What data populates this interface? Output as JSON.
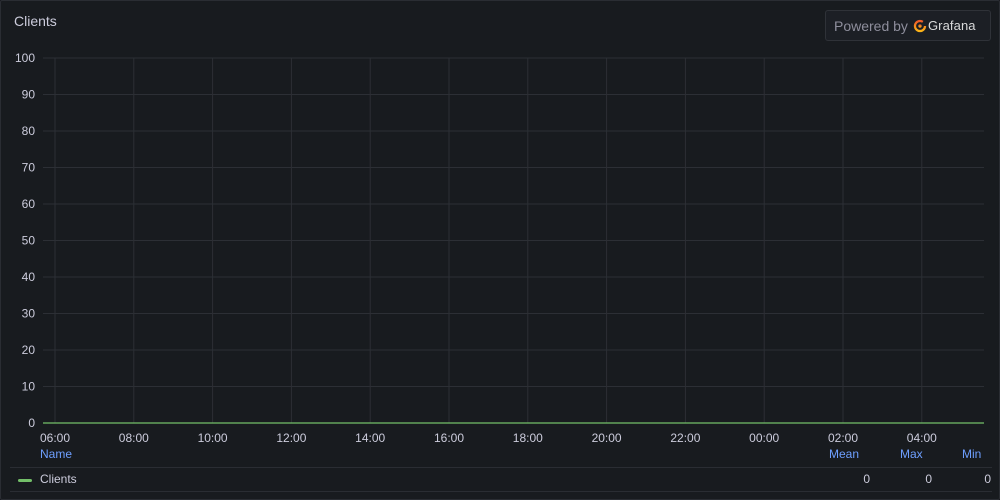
{
  "panel": {
    "title": "Clients"
  },
  "branding": {
    "powered_by": "Powered by",
    "brand": "Grafana",
    "logo_icon": "grafana-logo-icon"
  },
  "legend": {
    "headers": {
      "name": "Name",
      "mean": "Mean",
      "max": "Max",
      "min": "Min"
    },
    "rows": [
      {
        "name": "Clients",
        "mean": "0",
        "max": "0",
        "min": "0",
        "color": "#73bf69"
      }
    ]
  },
  "chart_data": {
    "type": "line",
    "title": "Clients",
    "x": [
      "06:00",
      "08:00",
      "10:00",
      "12:00",
      "14:00",
      "16:00",
      "18:00",
      "20:00",
      "22:00",
      "00:00",
      "02:00",
      "04:00"
    ],
    "y_ticks": [
      0,
      10,
      20,
      30,
      40,
      50,
      60,
      70,
      80,
      90,
      100
    ],
    "ylim": [
      0,
      100
    ],
    "grid": true,
    "legend_placement": "bottom",
    "series": [
      {
        "name": "Clients",
        "color": "#73bf69",
        "values": [
          0,
          0,
          0,
          0,
          0,
          0,
          0,
          0,
          0,
          0,
          0,
          0
        ]
      }
    ]
  }
}
